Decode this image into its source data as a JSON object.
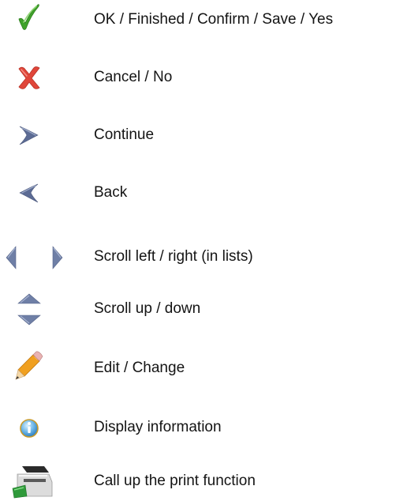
{
  "legend": {
    "items": [
      {
        "icon": "check-icon",
        "label": "OK / Finished / Confirm / Save / Yes"
      },
      {
        "icon": "cross-icon",
        "label": "Cancel / No"
      },
      {
        "icon": "chevron-right-icon",
        "label": "Continue"
      },
      {
        "icon": "chevron-left-icon",
        "label": "Back"
      },
      {
        "icon": "arrow-left-right-icon",
        "label": "Scroll left / right (in lists)"
      },
      {
        "icon": "arrow-up-down-icon",
        "label": "Scroll up / down"
      },
      {
        "icon": "pencil-icon",
        "label": "Edit / Change"
      },
      {
        "icon": "info-icon",
        "label": "Display information"
      },
      {
        "icon": "printer-icon",
        "label": "Call up the print function"
      }
    ]
  },
  "colors": {
    "check": "#3fa22a",
    "cross": "#e0463a",
    "arrow": "#5c6b94",
    "scroll": "#6f7fa6",
    "pencil": "#f0a020",
    "info": "#4a9fd6"
  }
}
